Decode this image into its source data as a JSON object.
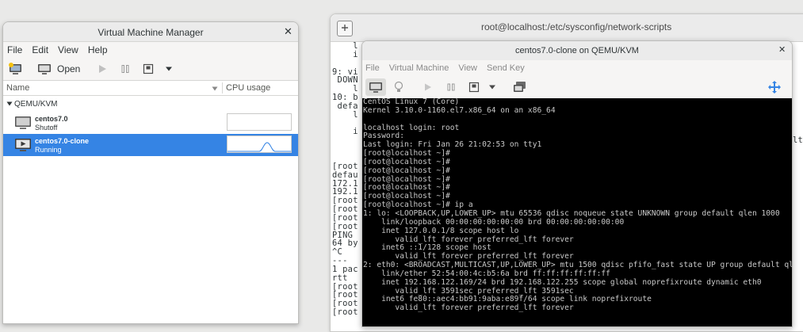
{
  "terminal": {
    "title": "root@localhost:/etc/sysconfig/network-scripts",
    "lines": [
      "    l",
      "    i",
      "",
      "9: vi",
      " DOWN",
      "    l",
      "10: b",
      " defa",
      "    l",
      "",
      "    i",
      "",
      "",
      "",
      "[root",
      "defau",
      "172.1",
      "192.1",
      "[root",
      "[root",
      "[root",
      "[root",
      "PING",
      "64 by",
      "^C",
      "---",
      "1 pac",
      "rtt",
      "[root",
      "[root",
      "[root",
      "[root"
    ],
    "right_lines": [
      "",
      "",
      "",
      "",
      "",
      "",
      "",
      "",
      "",
      "",
      "",
      "lt"
    ]
  },
  "vmm": {
    "title": "Virtual Machine Manager",
    "menu": [
      "File",
      "Edit",
      "View",
      "Help"
    ],
    "toolbar": {
      "open_label": "Open"
    },
    "columns": {
      "name": "Name",
      "cpu": "CPU usage"
    },
    "group": "QEMU/KVM",
    "vms": [
      {
        "name": "centos7.0",
        "status": "Shutoff",
        "selected": false
      },
      {
        "name": "centos7.0-clone",
        "status": "Running",
        "selected": true
      }
    ]
  },
  "console": {
    "title": "centos7.0-clone on QEMU/KVM",
    "menu": [
      "File",
      "Virtual Machine",
      "View",
      "Send Key"
    ],
    "lines": [
      "CentOS Linux 7 (Core)",
      "Kernel 3.10.0-1160.el7.x86_64 on an x86_64",
      "",
      "localhost login: root",
      "Password:",
      "Last login: Fri Jan 26 21:02:53 on tty1",
      "[root@localhost ~]#",
      "[root@localhost ~]#",
      "[root@localhost ~]#",
      "[root@localhost ~]#",
      "[root@localhost ~]#",
      "[root@localhost ~]#",
      "[root@localhost ~]# ip a",
      "1: lo: <LOOPBACK,UP,LOWER_UP> mtu 65536 qdisc noqueue state UNKNOWN group default qlen 1000",
      "    link/loopback 00:00:00:00:00:00 brd 00:00:00:00:00:00",
      "    inet 127.0.0.1/8 scope host lo",
      "       valid_lft forever preferred_lft forever",
      "    inet6 ::1/128 scope host",
      "       valid_lft forever preferred_lft forever",
      "2: eth0: <BROADCAST,MULTICAST,UP,LOWER_UP> mtu 1500 qdisc pfifo_fast state UP group default qlen 1000",
      "    link/ether 52:54:00:4c:b5:6a brd ff:ff:ff:ff:ff:ff",
      "    inet 192.168.122.169/24 brd 192.168.122.255 scope global noprefixroute dynamic eth0",
      "       valid_lft 3591sec preferred_lft 3591sec",
      "    inet6 fe80::aec4:bb91:9aba:e89f/64 scope link noprefixroute",
      "       valid_lft forever preferred_lft forever"
    ]
  },
  "colors": {
    "selection": "#3584e4",
    "terminal_bg": "#ffffff",
    "console_bg": "#000000"
  }
}
